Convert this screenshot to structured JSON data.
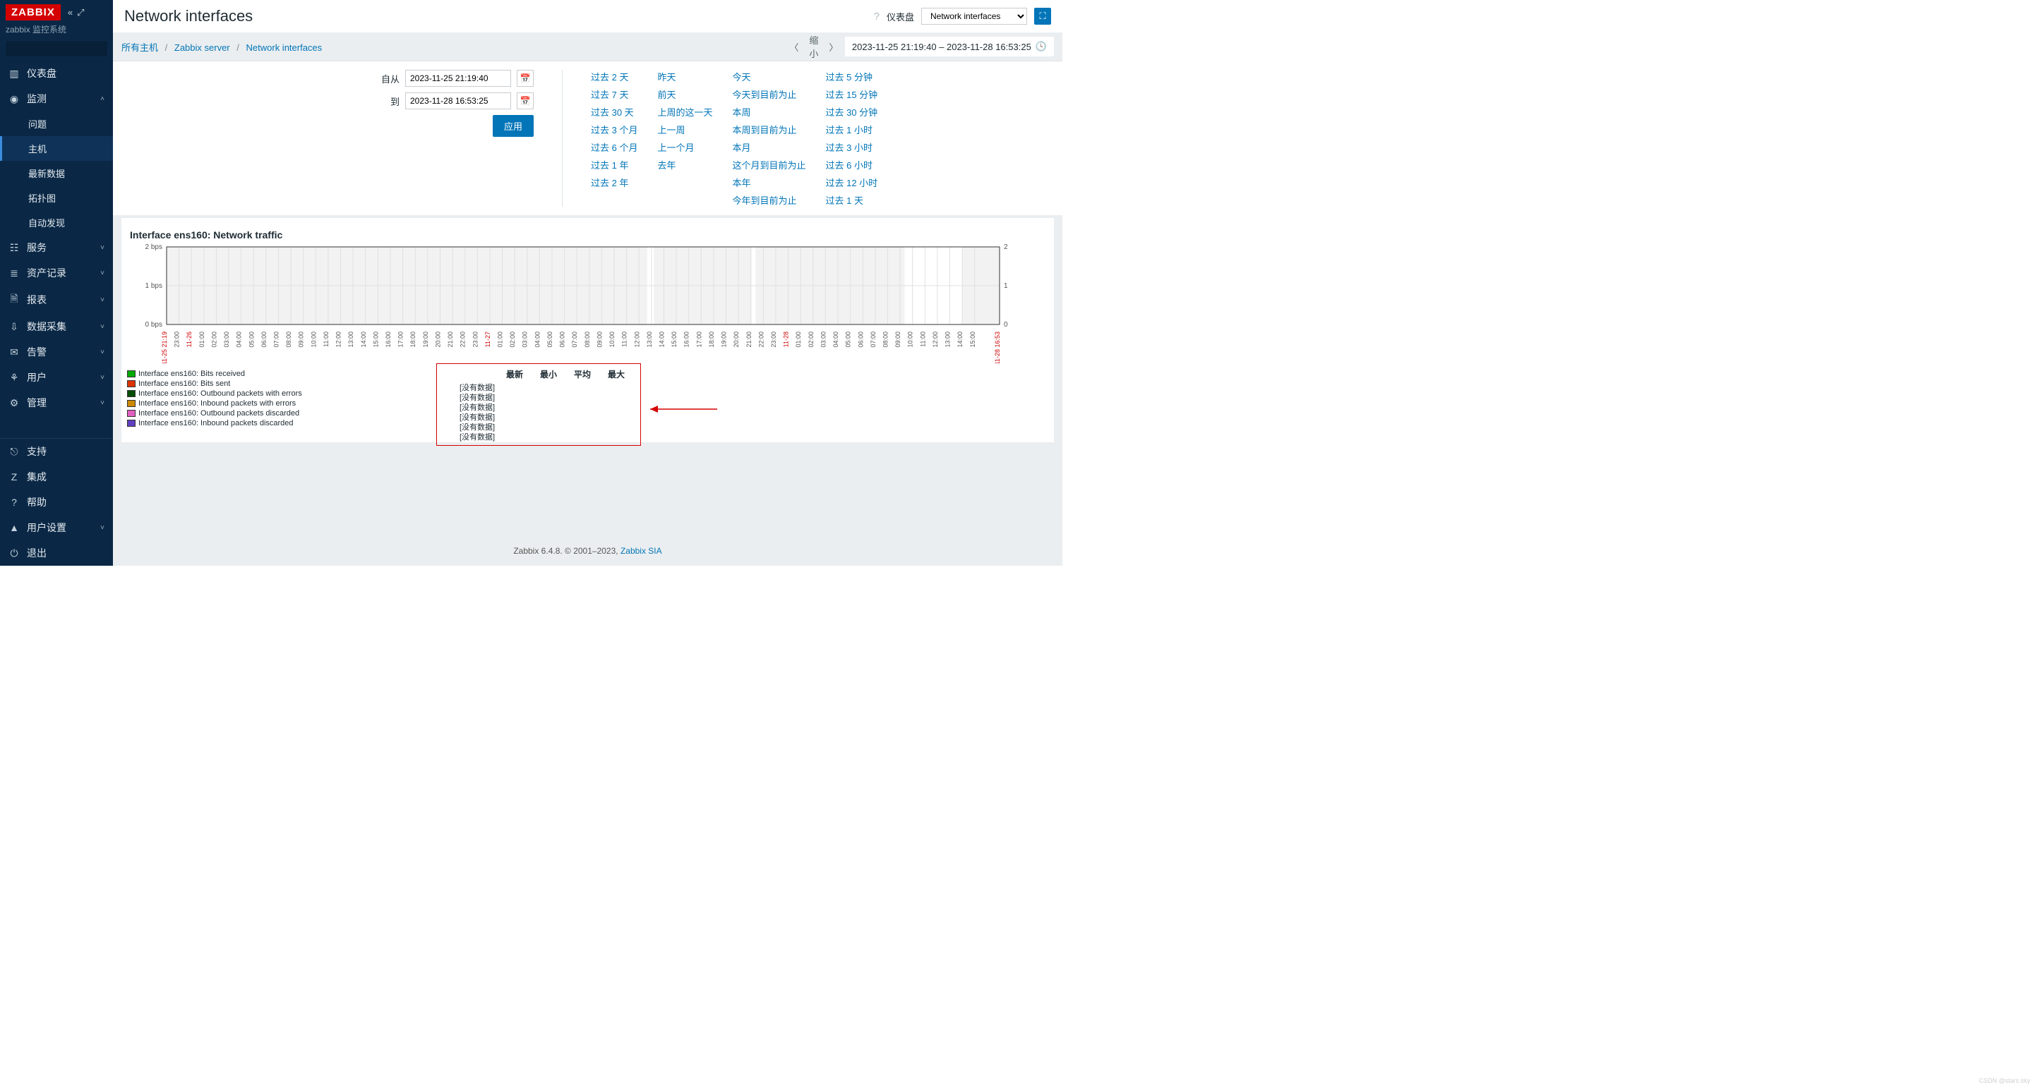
{
  "brand": {
    "logo": "ZABBIX",
    "subtitle": "zabbix 监控系统"
  },
  "search": {
    "placeholder": ""
  },
  "sidebar": {
    "top": [
      {
        "icon": "▥",
        "label": "仪表盘",
        "caret": ""
      },
      {
        "icon": "◉",
        "label": "监测",
        "caret": "˄",
        "expanded": true,
        "children": [
          {
            "label": "问题"
          },
          {
            "label": "主机",
            "active": true
          },
          {
            "label": "最新数据"
          },
          {
            "label": "拓扑图"
          },
          {
            "label": "自动发现"
          }
        ]
      },
      {
        "icon": "☷",
        "label": "服务",
        "caret": "˅"
      },
      {
        "icon": "≣",
        "label": "资产记录",
        "caret": "˅"
      },
      {
        "icon": "🗎",
        "label": "报表",
        "caret": "˅"
      },
      {
        "icon": "⇩",
        "label": "数据采集",
        "caret": "˅"
      },
      {
        "icon": "✉",
        "label": "告警",
        "caret": "˅"
      },
      {
        "icon": "⚘",
        "label": "用户",
        "caret": "˅"
      },
      {
        "icon": "⚙",
        "label": "管理",
        "caret": "˅"
      }
    ],
    "bottom": [
      {
        "icon": "⎋",
        "label": "支持"
      },
      {
        "icon": "Z",
        "label": "集成"
      },
      {
        "icon": "?",
        "label": "帮助"
      },
      {
        "icon": "▲",
        "label": "用户设置",
        "caret": "˅"
      },
      {
        "icon": "⏻",
        "label": "退出"
      }
    ]
  },
  "header": {
    "title": "Network interfaces",
    "dashboard_label": "仪表盘",
    "dashboard_value": "Network interfaces"
  },
  "breadcrumb": {
    "items": [
      "所有主机",
      "Zabbix server",
      "Network interfaces"
    ],
    "zoom_out": "缩小",
    "range_text": "2023-11-25 21:19:40 – 2023-11-28 16:53:25"
  },
  "time_filter": {
    "from_label": "自从",
    "from_value": "2023-11-25 21:19:40",
    "to_label": "到",
    "to_value": "2023-11-28 16:53:25",
    "apply": "应用",
    "presets": [
      [
        "过去 2 天",
        "过去 7 天",
        "过去 30 天",
        "过去 3 个月",
        "过去 6 个月",
        "过去 1 年",
        "过去 2 年"
      ],
      [
        "昨天",
        "前天",
        "上周的这一天",
        "上一周",
        "上一个月",
        "去年"
      ],
      [
        "今天",
        "今天到目前为止",
        "本周",
        "本周到目前为止",
        "本月",
        "这个月到目前为止",
        "本年",
        "今年到目前为止"
      ],
      [
        "过去 5 分钟",
        "过去 15 分钟",
        "过去 30 分钟",
        "过去 1 小时",
        "过去 3 小时",
        "过去 6 小时",
        "过去 12 小时",
        "过去 1 天"
      ]
    ]
  },
  "chart_data": {
    "type": "line",
    "title": "Interface ens160: Network traffic",
    "y_left": [
      {
        "v": 0,
        "label": "0 bps"
      },
      {
        "v": 1,
        "label": "1 bps"
      },
      {
        "v": 2,
        "label": "2 bps"
      }
    ],
    "y_right": [
      {
        "v": 0,
        "label": "0"
      },
      {
        "v": 1,
        "label": "1"
      },
      {
        "v": 2,
        "label": "2"
      }
    ],
    "x_range_start": "11-25 21:19",
    "x_range_end": "11-28 16:53",
    "x_day_markers": [
      "11-26",
      "11-27",
      "11-28"
    ],
    "x_hours": [
      "23:00",
      "00:00",
      "01:00",
      "02:00",
      "03:00",
      "04:00",
      "05:00",
      "06:00",
      "07:00",
      "08:00",
      "09:00",
      "10:00",
      "11:00",
      "12:00",
      "13:00",
      "14:00",
      "15:00",
      "16:00",
      "17:00",
      "18:00",
      "19:00",
      "20:00",
      "21:00",
      "22:00",
      "23:00",
      "00:00",
      "01:00",
      "02:00",
      "03:00",
      "04:00",
      "05:00",
      "06:00",
      "07:00",
      "08:00",
      "09:00",
      "10:00",
      "11:00",
      "12:00",
      "13:00",
      "14:00",
      "15:00",
      "16:00",
      "17:00",
      "18:00",
      "19:00",
      "20:00",
      "21:00",
      "22:00",
      "23:00",
      "00:00",
      "01:00",
      "02:00",
      "03:00",
      "04:00",
      "05:00",
      "06:00",
      "07:00",
      "08:00",
      "09:00",
      "10:00",
      "11:00",
      "12:00",
      "13:00",
      "14:00",
      "15:00"
    ],
    "white_gaps": [
      [
        0.577,
        0.585
      ],
      [
        0.702,
        0.707
      ],
      [
        0.886,
        0.955
      ]
    ],
    "series": [
      {
        "name": "Interface ens160: Bits received",
        "color": "#00aa00",
        "values": null,
        "status": "[没有数据]"
      },
      {
        "name": "Interface ens160: Bits sent",
        "color": "#dd3300",
        "values": null,
        "status": "[没有数据]"
      },
      {
        "name": "Interface ens160: Outbound packets with errors",
        "color": "#004d00",
        "values": null,
        "status": "[没有数据]"
      },
      {
        "name": "Interface ens160: Inbound packets with errors",
        "color": "#cc8800",
        "values": null,
        "status": "[没有数据]"
      },
      {
        "name": "Interface ens160: Outbound packets discarded",
        "color": "#e060c0",
        "values": null,
        "status": "[没有数据]"
      },
      {
        "name": "Interface ens160: Inbound packets discarded",
        "color": "#6040c0",
        "values": null,
        "status": "[没有数据]"
      }
    ],
    "legend_headers": [
      "最新",
      "最小",
      "平均",
      "最大"
    ]
  },
  "footer": {
    "text": "Zabbix 6.4.8. © 2001–2023, ",
    "link": "Zabbix SIA"
  },
  "watermark": "CSDN @stars.sky"
}
